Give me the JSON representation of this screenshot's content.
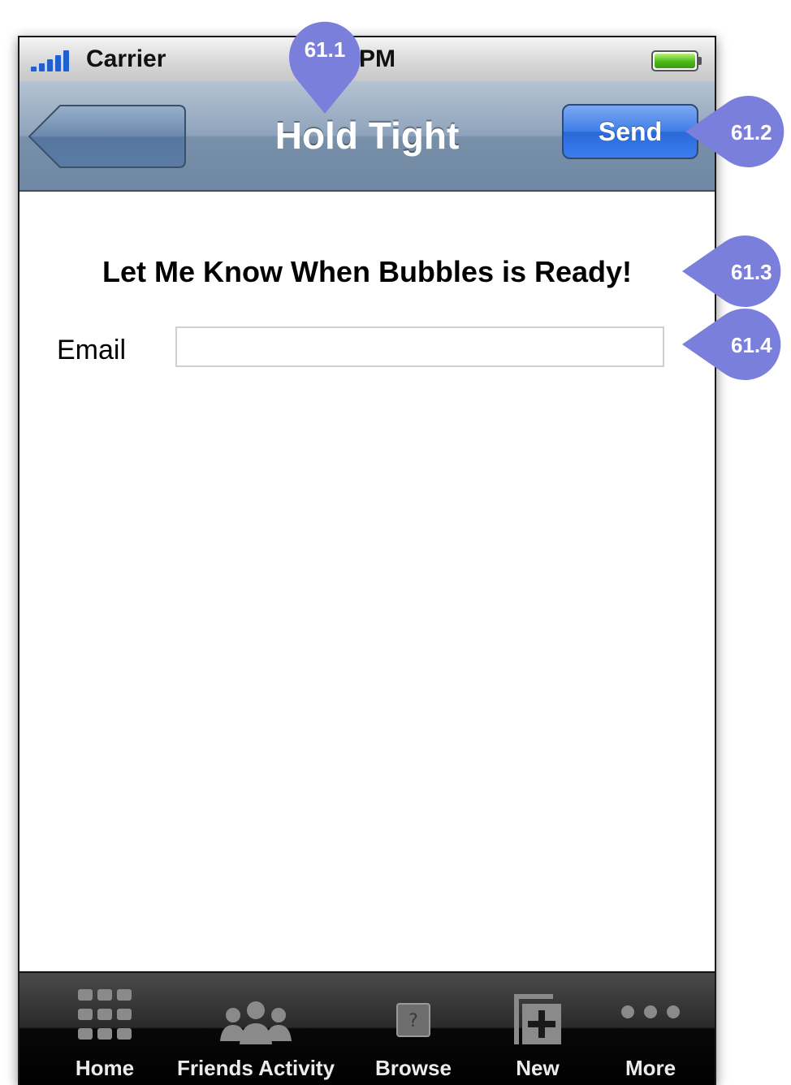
{
  "status_bar": {
    "carrier": "Carrier",
    "time": "4 PM"
  },
  "nav_bar": {
    "title": "Hold Tight",
    "send_label": "Send"
  },
  "content": {
    "heading": "Let Me Know When Bubbles is Ready!",
    "email_label": "Email",
    "email_value": "",
    "email_placeholder": ""
  },
  "tab_bar": {
    "tabs": [
      {
        "label": "Home",
        "icon": "grid-icon"
      },
      {
        "label": "Friends Activity",
        "icon": "people-icon"
      },
      {
        "label": "Browse",
        "icon": "question-icon"
      },
      {
        "label": "New",
        "icon": "plus-page-icon"
      },
      {
        "label": "More",
        "icon": "ellipsis-icon"
      }
    ]
  },
  "annotations": [
    {
      "label": "61.1"
    },
    {
      "label": "61.2"
    },
    {
      "label": "61.3"
    },
    {
      "label": "61.4"
    }
  ],
  "colors": {
    "callout": "#7b7fdc",
    "send_button": "#3b7ef0",
    "battery": "#4cbb17",
    "signal": "#1f5fd0"
  }
}
